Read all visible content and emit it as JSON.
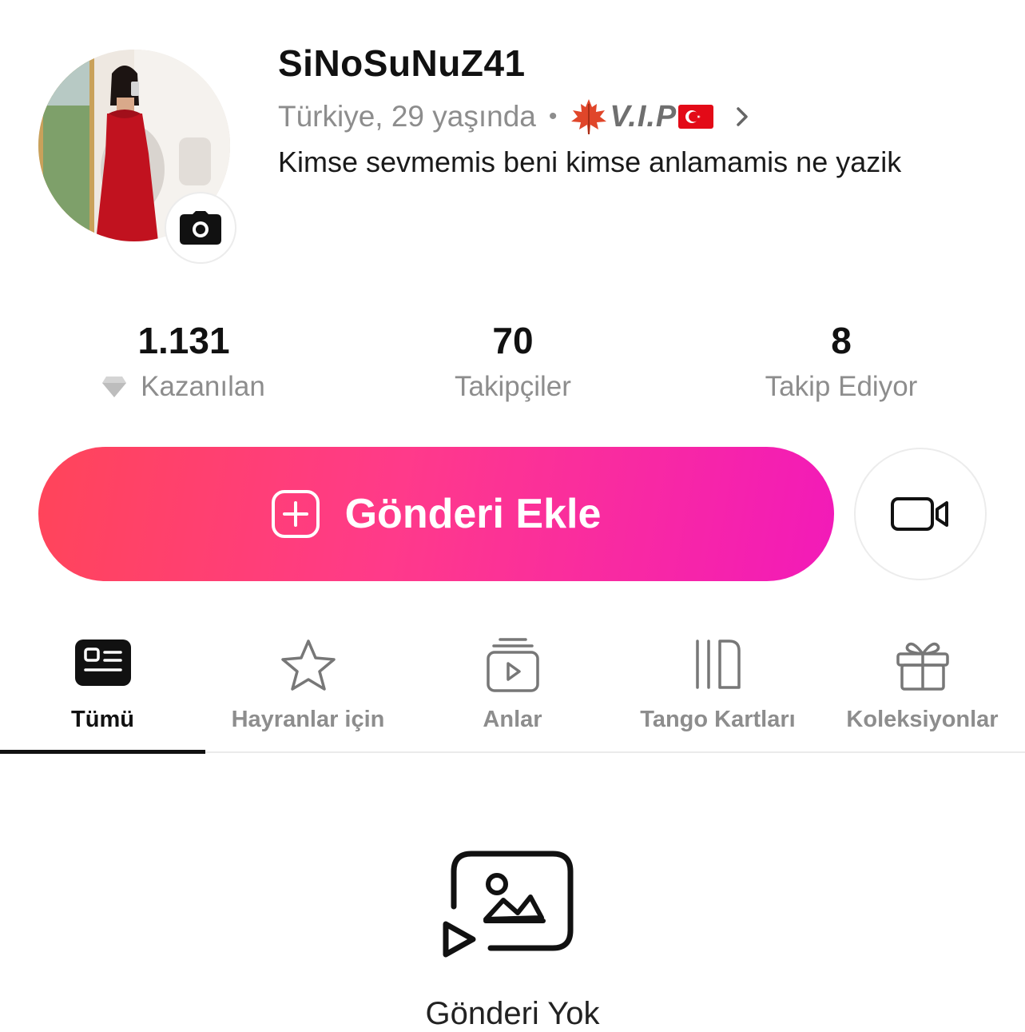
{
  "profile": {
    "username": "SiNoSuNuZ41",
    "location_age": "Türkiye, 29 yaşında",
    "separator": "•",
    "badge_text": "V.I.P",
    "bio": "Kimse sevmemis beni kimse anlamamis ne yazik",
    "badge_icons": [
      "maple-leaf-icon",
      "turkey-flag-icon"
    ],
    "avatar_badge_icon": "camera-icon"
  },
  "stats": [
    {
      "value": "1.131",
      "label": "Kazanılan",
      "icon": "diamond-icon"
    },
    {
      "value": "70",
      "label": "Takipçiler"
    },
    {
      "value": "8",
      "label": "Takip Ediyor"
    }
  ],
  "actions": {
    "add_post_label": "Gönderi Ekle",
    "add_post_icon": "plus-square-icon",
    "live_icon": "video-camera-icon"
  },
  "tabs": [
    {
      "label": "Tümü",
      "icon": "feed-icon",
      "active": true
    },
    {
      "label": "Hayranlar için",
      "icon": "star-icon",
      "active": false
    },
    {
      "label": "Anlar",
      "icon": "moments-play-icon",
      "active": false
    },
    {
      "label": "Tango Kartları",
      "icon": "cards-icon",
      "active": false
    },
    {
      "label": "Koleksiyonlar",
      "icon": "gift-icon",
      "active": false
    }
  ],
  "empty_state": {
    "message": "Gönderi Yok",
    "icon": "media-placeholder-icon"
  },
  "colors": {
    "accent_gradient": [
      "#ff4559",
      "#ff3a8a",
      "#f21ab9"
    ],
    "text_primary": "#111111",
    "text_secondary": "#8d8d8d"
  }
}
